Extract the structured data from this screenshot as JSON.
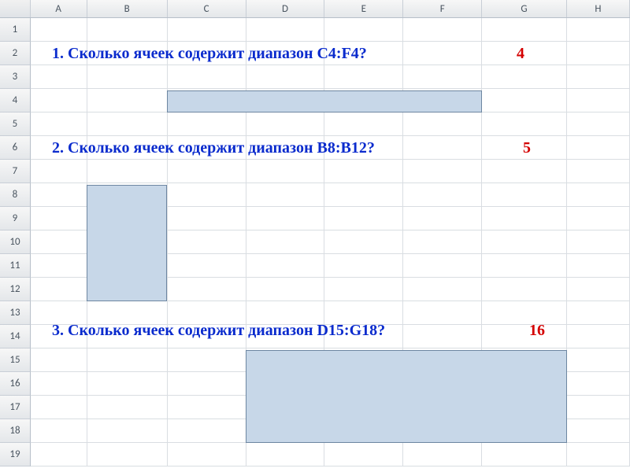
{
  "columns": [
    "A",
    "B",
    "C",
    "D",
    "E",
    "F",
    "G",
    "H"
  ],
  "row_count": 19,
  "questions": {
    "q1": {
      "text": "1. Сколько ячеек содержит диапазон C4:F4?",
      "answer": "4"
    },
    "q2": {
      "text": "2. Сколько ячеек содержит диапазон B8:B12?",
      "answer": "5"
    },
    "q3": {
      "text": "3. Сколько ячеек содержит диапазон D15:G18?",
      "answer": "16"
    }
  },
  "ranges": {
    "r1": "C4:F4",
    "r2": "B8:B12",
    "r3": "D15:G18"
  }
}
